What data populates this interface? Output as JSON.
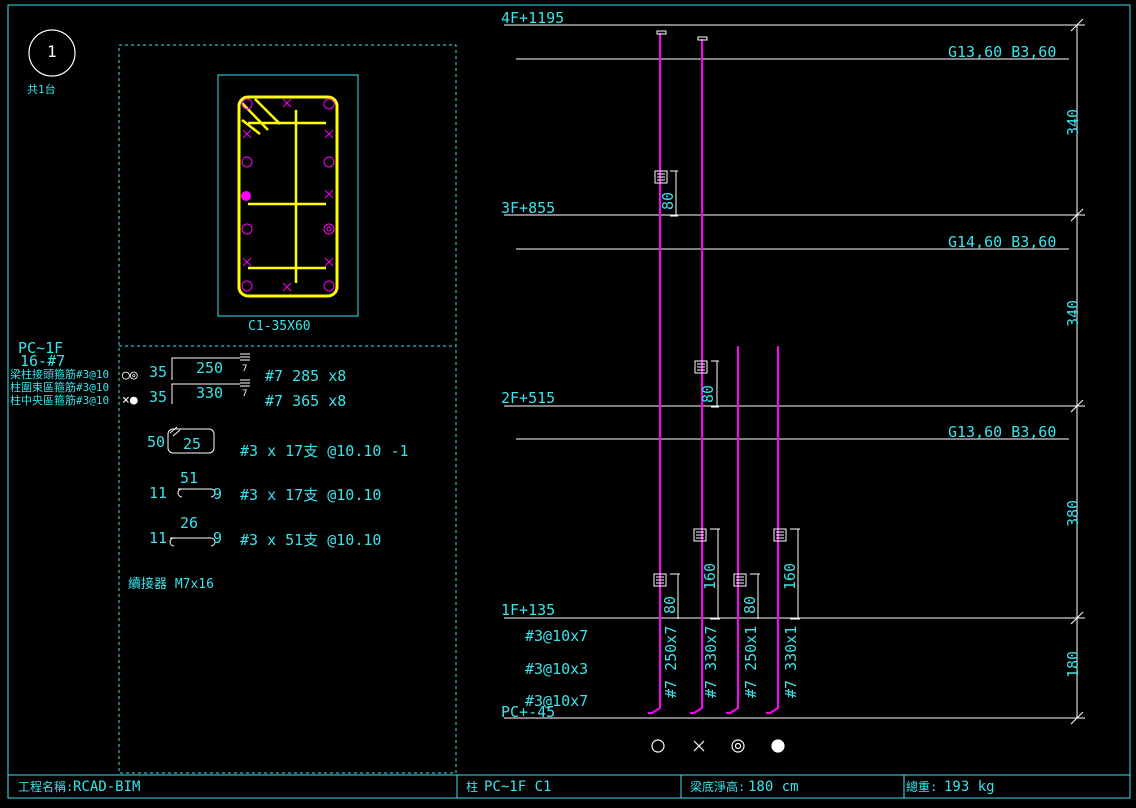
{
  "header": {
    "sheet_number": "1",
    "sheet_label": "共1台"
  },
  "section": {
    "caption": "C1-35X60",
    "name": "PC~1F",
    "bar_spec": "16-#7"
  },
  "stirrup_notes": [
    "梁柱接頭箍筋#3@10",
    "柱圍束區箍筋#3@10",
    "柱中央區箍筋#3@10"
  ],
  "bar_schedule": [
    {
      "symbols": "○◎",
      "lead": "35",
      "length": "250",
      "hook": "7",
      "desc": "#7 285 x8"
    },
    {
      "symbols": "×●",
      "lead": "35",
      "length": "330",
      "hook": "7",
      "desc": "#7 365 x8"
    }
  ],
  "ties": [
    {
      "a": "50",
      "b": "25",
      "desc": "#3 x 17支 @10.10 -1"
    },
    {
      "a": "11",
      "b": "51",
      "c": "9",
      "desc": "#3 x 17支 @10.10"
    },
    {
      "a": "11",
      "b": "26",
      "c": "9",
      "desc": "#3 x 51支 @10.10"
    }
  ],
  "coupler": "續接器 M7x16",
  "elevation": {
    "levels": [
      {
        "label": "4F+1195"
      },
      {
        "label": "3F+855"
      },
      {
        "label": "2F+515"
      },
      {
        "label": "1F+135"
      },
      {
        "label": "PC+-45"
      }
    ],
    "beams": [
      "G13,60 B3,60",
      "G14,60 B3,60",
      "G13,60 B3,60"
    ],
    "story_dims": [
      "340",
      "340",
      "380",
      "180"
    ],
    "lap_dims": [
      "80",
      "80",
      "80",
      "160",
      "80",
      "160"
    ],
    "stirrup_spacing": [
      "#3@10x7",
      "#3@10x3",
      "#3@10x7"
    ],
    "bar_labels": [
      "#7 250x7",
      "#7 330x7",
      "#7 250x1",
      "#7 330x1"
    ],
    "legend_symbols": [
      "○",
      "×",
      "◎",
      "●"
    ]
  },
  "status_bar": {
    "project_label": "工程名稱:",
    "project_value": "RCAD-BIM",
    "column_label": "柱",
    "column_value": "PC~1F C1",
    "height_label": "梁底淨高:",
    "height_value": "180 cm",
    "weight_label": "總重:",
    "weight_value": "193 kg"
  },
  "colors": {
    "line": "#38e4ec",
    "text": "#38e4ec",
    "rebar": "#ffff00",
    "bar": "#ff00ff",
    "white": "#ffffff",
    "background": "#000000"
  }
}
